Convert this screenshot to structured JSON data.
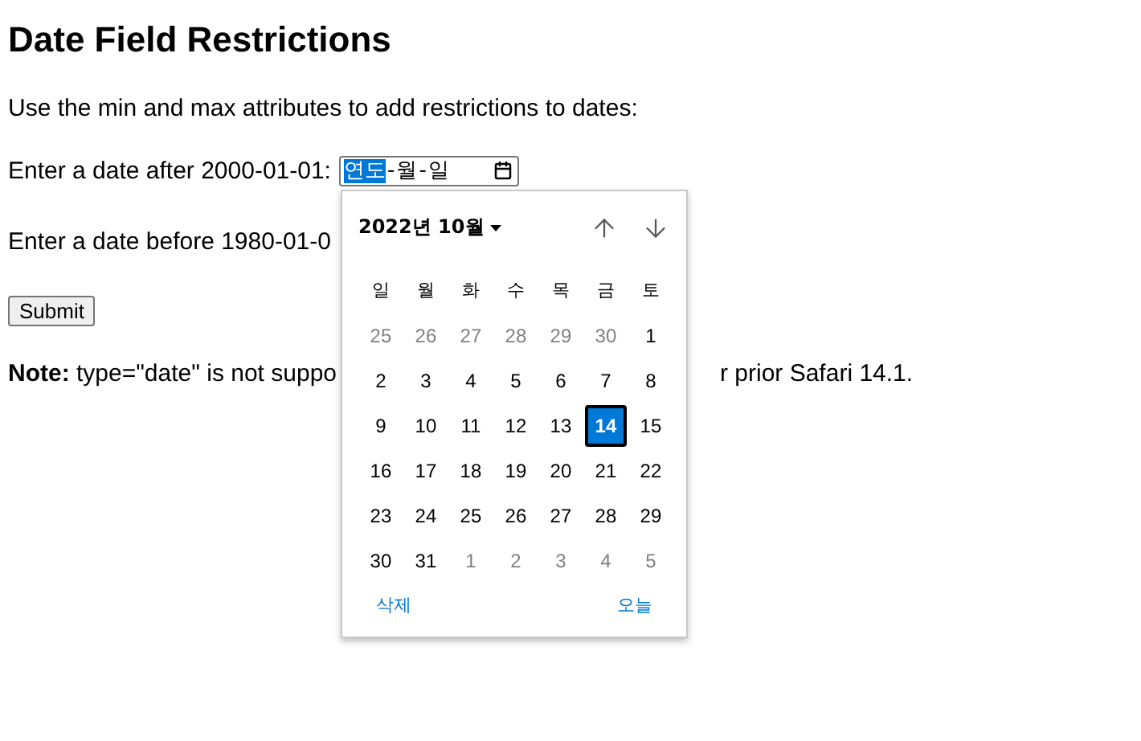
{
  "heading": "Date Field Restrictions",
  "intro": "Use the min and max attributes to add restrictions to dates:",
  "field_after": {
    "label": "Enter a date after 2000-01-01:",
    "segments": [
      {
        "label": "연도",
        "selected": true
      },
      {
        "label": "월",
        "selected": false
      },
      {
        "label": "일",
        "selected": false
      }
    ],
    "separators": [
      "-",
      "-"
    ]
  },
  "field_before": {
    "label": "Enter a date before 1980-01-0"
  },
  "submit": "Submit",
  "note": {
    "left": "**Note:** type=\"date\" is not suppo",
    "right": "r prior Safari 14.1."
  },
  "calendar": {
    "month": "2022년 10월",
    "weekdays": [
      "일",
      "월",
      "화",
      "수",
      "목",
      "금",
      "토"
    ],
    "days": [
      {
        "label": "25",
        "kind": "outside",
        "selected": false
      },
      {
        "label": "26",
        "kind": "outside",
        "selected": false
      },
      {
        "label": "27",
        "kind": "outside",
        "selected": false
      },
      {
        "label": "28",
        "kind": "outside",
        "selected": false
      },
      {
        "label": "29",
        "kind": "outside",
        "selected": false
      },
      {
        "label": "30",
        "kind": "outside",
        "selected": false
      },
      {
        "label": "1",
        "kind": "inside",
        "selected": false
      },
      {
        "label": "2",
        "kind": "inside",
        "selected": false
      },
      {
        "label": "3",
        "kind": "inside",
        "selected": false
      },
      {
        "label": "4",
        "kind": "inside",
        "selected": false
      },
      {
        "label": "5",
        "kind": "inside",
        "selected": false
      },
      {
        "label": "6",
        "kind": "inside",
        "selected": false
      },
      {
        "label": "7",
        "kind": "inside",
        "selected": false
      },
      {
        "label": "8",
        "kind": "inside",
        "selected": false
      },
      {
        "label": "9",
        "kind": "inside",
        "selected": false
      },
      {
        "label": "10",
        "kind": "inside",
        "selected": false
      },
      {
        "label": "11",
        "kind": "inside",
        "selected": false
      },
      {
        "label": "12",
        "kind": "inside",
        "selected": false
      },
      {
        "label": "13",
        "kind": "inside",
        "selected": false
      },
      {
        "label": "14",
        "kind": "inside",
        "selected": true
      },
      {
        "label": "15",
        "kind": "inside",
        "selected": false
      },
      {
        "label": "16",
        "kind": "inside",
        "selected": false
      },
      {
        "label": "17",
        "kind": "inside",
        "selected": false
      },
      {
        "label": "18",
        "kind": "inside",
        "selected": false
      },
      {
        "label": "19",
        "kind": "inside",
        "selected": false
      },
      {
        "label": "20",
        "kind": "inside",
        "selected": false
      },
      {
        "label": "21",
        "kind": "inside",
        "selected": false
      },
      {
        "label": "22",
        "kind": "inside",
        "selected": false
      },
      {
        "label": "23",
        "kind": "inside",
        "selected": false
      },
      {
        "label": "24",
        "kind": "inside",
        "selected": false
      },
      {
        "label": "25",
        "kind": "inside",
        "selected": false
      },
      {
        "label": "26",
        "kind": "inside",
        "selected": false
      },
      {
        "label": "27",
        "kind": "inside",
        "selected": false
      },
      {
        "label": "28",
        "kind": "inside",
        "selected": false
      },
      {
        "label": "29",
        "kind": "inside",
        "selected": false
      },
      {
        "label": "30",
        "kind": "inside",
        "selected": false
      },
      {
        "label": "31",
        "kind": "inside",
        "selected": false
      },
      {
        "label": "1",
        "kind": "outside",
        "selected": false
      },
      {
        "label": "2",
        "kind": "outside",
        "selected": false
      },
      {
        "label": "3",
        "kind": "outside",
        "selected": false
      },
      {
        "label": "4",
        "kind": "outside",
        "selected": false
      },
      {
        "label": "5",
        "kind": "outside",
        "selected": false
      }
    ],
    "clear": "삭제",
    "today": "오늘"
  }
}
